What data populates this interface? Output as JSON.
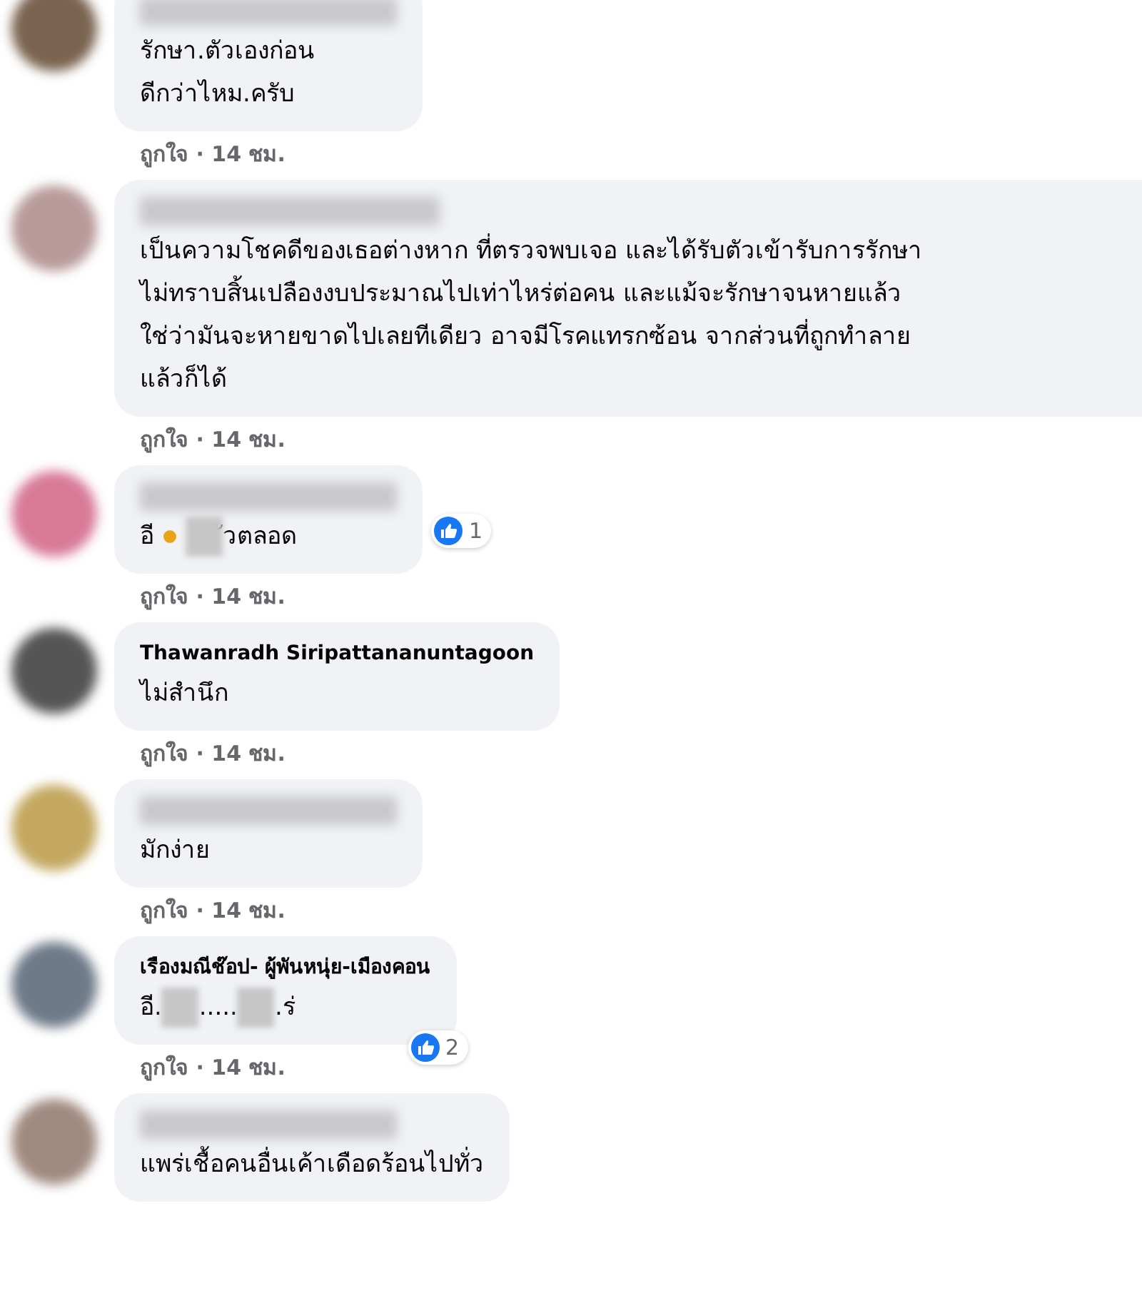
{
  "comments": [
    {
      "color": "#7a6450",
      "name": {
        "kind": "blur"
      },
      "lines": [
        [
          {
            "kind": "text",
            "text": "รักษา.ตัวเองก่อน"
          }
        ],
        [
          {
            "kind": "text",
            "text": "ดีกว่าไหม.ครับ"
          }
        ]
      ],
      "meta": "ถูกใจ · 14 ชม."
    },
    {
      "color": "#b89a9a",
      "name": {
        "kind": "blur"
      },
      "lines": [
        [
          {
            "kind": "text",
            "text": "เป็นความโชคดีของเธอต่างหาก ที่ตรวจพบเจอ และได้รับตัวเข้ารับการรักษา"
          }
        ],
        [
          {
            "kind": "text",
            "text": "ไม่ทราบสิ้นเปลืองงบประมาณไปเท่าไหร่ต่อคน และแม้จะรักษาจนหายแล้ว"
          }
        ],
        [
          {
            "kind": "text",
            "text": "ใช่ว่ามันจะหายขาดไปเลยทีเดียว อาจมีโรคแทรกซ้อน จากส่วนที่ถูกทำลาย"
          }
        ],
        [
          {
            "kind": "text",
            "text": "แล้วก็ได้"
          }
        ]
      ],
      "meta": "ถูกใจ · 14 ชม."
    },
    {
      "color": "#d87a98",
      "name": {
        "kind": "blur"
      },
      "lines": [
        [
          {
            "kind": "text",
            "text": "อี"
          },
          {
            "kind": "emoji"
          },
          {
            "kind": "blur"
          },
          {
            "kind": "text",
            "text": "ัวตลอด"
          }
        ]
      ],
      "reactions": "1",
      "meta": "ถูกใจ · 14 ชม."
    },
    {
      "color": "#555555",
      "name": {
        "kind": "text",
        "text": "Thawanradh Siripattananuntagoon"
      },
      "lines": [
        [
          {
            "kind": "text",
            "text": "ไม่สำนึก"
          }
        ]
      ],
      "meta": "ถูกใจ · 14 ชม."
    },
    {
      "color": "#c4a860",
      "name": {
        "kind": "blur"
      },
      "lines": [
        [
          {
            "kind": "text",
            "text": "มักง่าย"
          }
        ]
      ],
      "meta": "ถูกใจ · 14 ชม."
    },
    {
      "color": "#6e7a88",
      "name": {
        "kind": "text",
        "text": "เรืองมณีช๊อป- ผู้พันหนุ่ย-เมืองคอน"
      },
      "lines": [
        [
          {
            "kind": "text",
            "text": "อี."
          },
          {
            "kind": "blur"
          },
          {
            "kind": "text",
            "text": "....."
          },
          {
            "kind": "blur"
          },
          {
            "kind": "text",
            "text": ".ร่"
          }
        ]
      ],
      "reactions": "2",
      "meta": "ถูกใจ · 14 ชม."
    },
    {
      "color": "#a08a80",
      "name": {
        "kind": "blur"
      },
      "lines": [
        [
          {
            "kind": "text",
            "text": "แพร่เชื้อคนอื่นเค้าเดือดร้อนไปทั่ว"
          }
        ]
      ]
    }
  ]
}
